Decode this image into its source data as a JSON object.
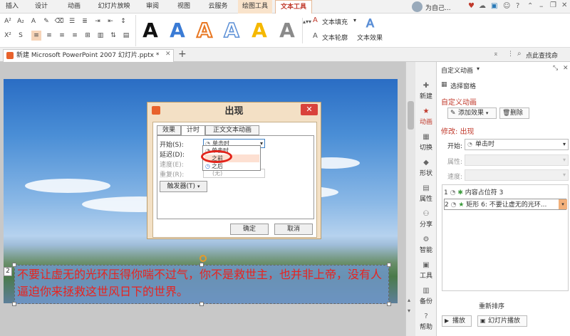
{
  "menubar": {
    "tabs": [
      "插入",
      "设计",
      "动画",
      "幻灯片放映",
      "审阅",
      "视图",
      "云服务",
      "绘图工具",
      "文本工具"
    ],
    "account": "为自己...",
    "active_tab": "文本工具",
    "highlight_tab": "绘图工具"
  },
  "ribbon": {
    "text_fill": "文本填充",
    "text_outline": "文本轮廓",
    "text_effect": "文本效果",
    "style_glyph": "A"
  },
  "colors": {
    "accent": "#c0392b",
    "style_colors": [
      "#111111",
      "#3a7bd5",
      "#e87722",
      "#5b8fd6",
      "#f5b800",
      "#8a8a8a"
    ]
  },
  "tabs": {
    "doc_title": "新建 Microsoft PowerPoint 2007 幻灯片.pptx *",
    "new_tab": "+",
    "right_text": "点此查找命"
  },
  "slide": {
    "number": "2",
    "text": "不要让虚无的光环压得你喘不过气，你不是救世主，也并非上帝，没有人逼迫你来拯救这世风日下的世界。"
  },
  "sidebar": {
    "items": [
      "新建",
      "动画",
      "切换",
      "形状",
      "属性",
      "分享",
      "智能",
      "工具",
      "备份",
      "帮助"
    ]
  },
  "panel": {
    "title": "自定义动画",
    "select_pane": "选择窗格",
    "section_custom": "自定义动画",
    "add_effect": "添加效果",
    "delete": "删除",
    "modify_title": "修改: 出现",
    "start_label": "开始:",
    "start_value": "单击时",
    "property_label": "属性:",
    "speed_label": "速度:",
    "list": [
      {
        "num": "1",
        "text": "内容占位符 3"
      },
      {
        "num": "2",
        "text": "矩形 6: 不要让虚无的光环..."
      }
    ],
    "reorder": "重新排序",
    "play": "播放",
    "slideshow": "幻灯片播放"
  },
  "dialog": {
    "title": "出现",
    "close": "✕",
    "tabs": [
      "效果",
      "计时",
      "正文文本动画"
    ],
    "start_label": "开始(S):",
    "start_value": "单击时",
    "delay_label": "延迟(D):",
    "speed_label": "速度(E):",
    "repeat_label": "重复(R):",
    "repeat_value": "(无)",
    "trigger": "触发器(T)",
    "ok": "确定",
    "cancel": "取消",
    "dropdown": [
      "单击时",
      "之前",
      "之后"
    ]
  }
}
